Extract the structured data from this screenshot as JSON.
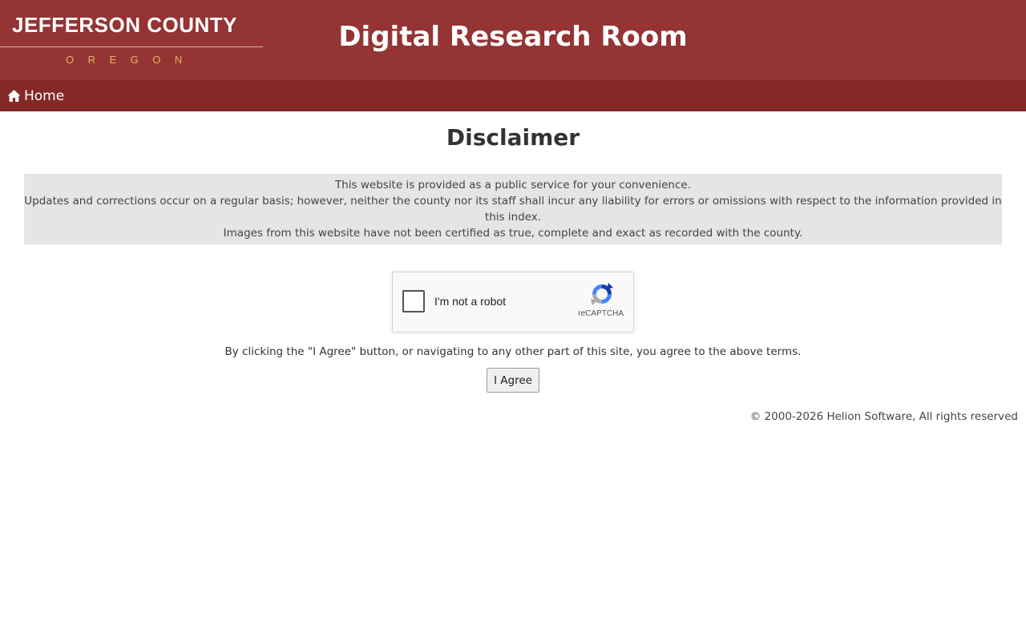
{
  "header": {
    "logo_name": "JEFFERSON COUNTY",
    "logo_state": "OREGON",
    "site_title": "Digital Research Room"
  },
  "nav": {
    "home_label": "Home",
    "home_icon": "home-icon"
  },
  "main": {
    "heading": "Disclaimer",
    "disclaimer_lines": [
      "This website is provided as a public service for your convenience.",
      "Updates and corrections occur on a regular basis; however, neither the county nor its staff shall incur any liability for errors or omissions with respect to the information provided in this index.",
      "Images from this website have not been certified as true, complete and exact as recorded with the county."
    ],
    "captcha": {
      "label": "I'm not a robot",
      "brand": "reCAPTCHA",
      "icon": "recaptcha-logo-icon"
    },
    "agree_text": "By clicking the \"I Agree\" button, or navigating to any other part of this site, you agree to the above terms.",
    "agree_button": "I Agree"
  },
  "footer": {
    "copyright": "© 2000-2026 Helion Software, All rights reserved"
  },
  "colors": {
    "header_bg": "#943434",
    "navbar_bg": "#842828",
    "logo_state": "#e8b45c",
    "disclaimer_bg": "#e5e5e5"
  }
}
